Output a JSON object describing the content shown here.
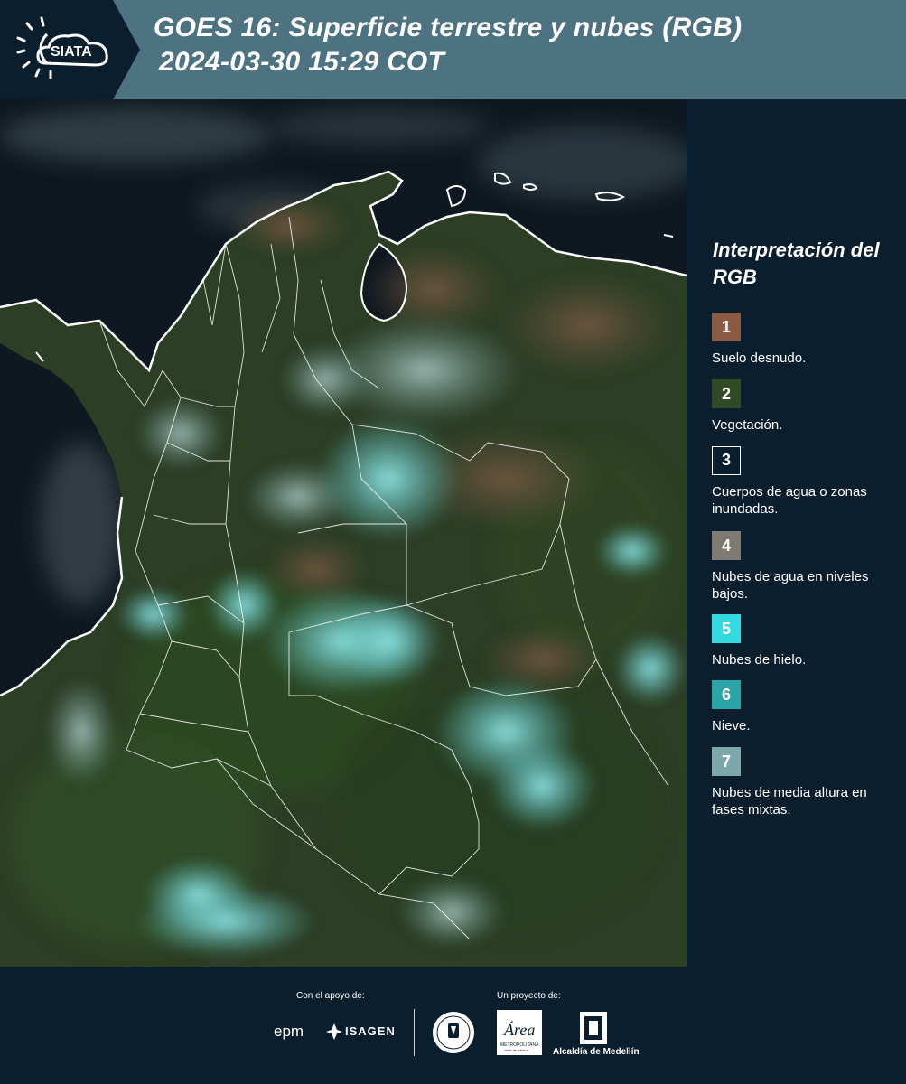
{
  "header": {
    "logo_text": "SIATA",
    "title_line1": "GOES 16: Superficie terrestre y nubes (RGB)",
    "title_line2": "2024-03-30 15:29 COT"
  },
  "legend": {
    "title": "Interpretación del RGB",
    "items": [
      {
        "number": "1",
        "label": "Suelo desnudo.",
        "color": "#8a5a45"
      },
      {
        "number": "2",
        "label": "Vegetación.",
        "color": "#2f4a25"
      },
      {
        "number": "3",
        "label": "Cuerpos de agua o zonas inundadas.",
        "color": "#0b1e2d"
      },
      {
        "number": "4",
        "label": "Nubes de agua en niveles bajos.",
        "color": "#7f7a72"
      },
      {
        "number": "5",
        "label": "Nubes de hielo.",
        "color": "#33dbe0"
      },
      {
        "number": "6",
        "label": "Nieve.",
        "color": "#2aa4a6"
      },
      {
        "number": "7",
        "label": "Nubes de media altura en fases mixtas.",
        "color": "#7ea7aa"
      }
    ]
  },
  "footer": {
    "support_label": "Con el apoyo de:",
    "project_label": "Un proyecto de:",
    "epm_text": "epm",
    "isagen_text": "ISAGEN",
    "area_text": "Área",
    "area_subtext": "METROPOLITANA",
    "area_subtext2": "Valle de Aburrá",
    "alcaldia_text": "Alcaldía de Medellín"
  },
  "colors": {
    "header_bg": "#4d7383",
    "dark_bg": "#0b1e2d",
    "cloud_cyan": "#6fd8dc",
    "vegetation": "#2f4a25",
    "ocean": "#0f1820"
  },
  "icons": [
    "sun-cloud-logo-icon",
    "epm-logo-icon",
    "isagen-logo-icon",
    "medellin-seal-icon",
    "area-metropolitana-logo-icon",
    "alcaldia-logo-icon"
  ]
}
